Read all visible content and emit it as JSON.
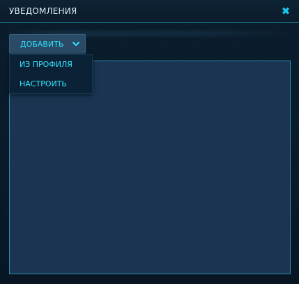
{
  "window": {
    "title": "Уведомления",
    "close_icon": "close-icon"
  },
  "toolbar": {
    "add_label": "Добавить",
    "add_icon": "chevron-down-icon"
  },
  "add_menu": {
    "items": [
      {
        "label": "Из профиля"
      },
      {
        "label": "Настроить"
      }
    ]
  },
  "colors": {
    "accent": "#2fe3ff",
    "panel": "#1a3452",
    "border": "#2b8fb0",
    "background": "#0a1a29"
  }
}
